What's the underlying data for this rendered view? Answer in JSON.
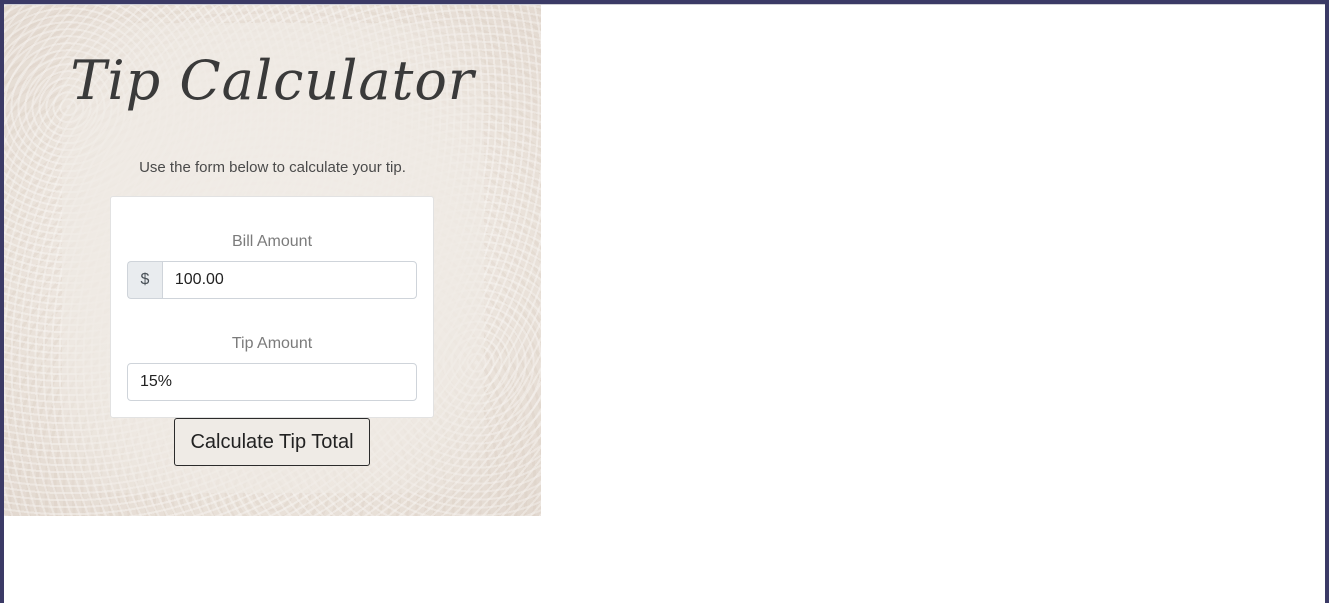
{
  "card": {
    "title": "Tip Calculator",
    "subtitle": "Use the form below to calculate your tip."
  },
  "form": {
    "bill": {
      "label": "Bill Amount",
      "prefix": "$",
      "value": "100.00"
    },
    "tip": {
      "label": "Tip Amount",
      "value": "15%"
    },
    "submit_label": "Calculate Tip Total"
  },
  "colors": {
    "outer_background": "#3b3a66",
    "card_background": "#efe9e3",
    "button_border": "#2b2b2b"
  }
}
